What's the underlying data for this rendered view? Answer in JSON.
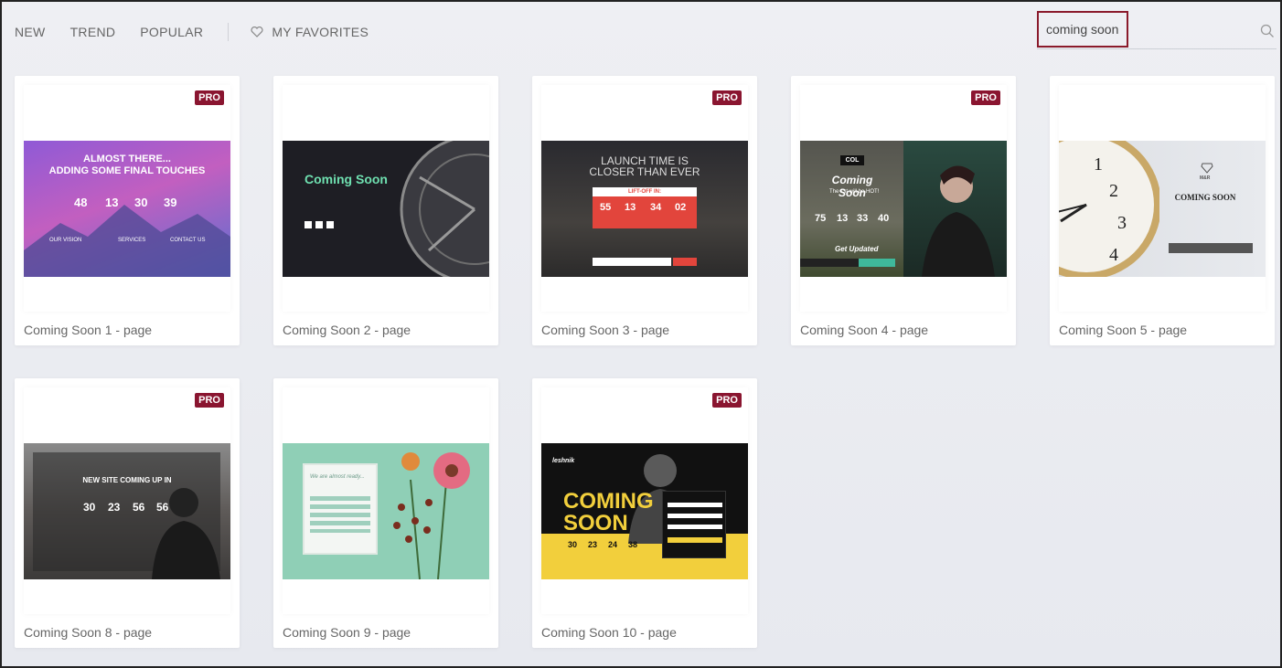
{
  "nav": {
    "tabs": [
      "NEW",
      "TREND",
      "POPULAR"
    ],
    "favorites_label": "MY FAVORITES"
  },
  "search": {
    "value": "coming soon"
  },
  "colors": {
    "pro_badge": "#8a1530",
    "search_highlight": "#8a1a2b"
  },
  "cards": [
    {
      "label": "Coming Soon 1 - page",
      "pro": true,
      "badge": "PRO",
      "thumb": {
        "headline1": "ALMOST THERE...",
        "headline2": "ADDING SOME FINAL TOUCHES",
        "nums": [
          "48",
          "13",
          "30",
          "39"
        ],
        "cols": [
          "OUR VISION",
          "SERVICES",
          "CONTACT US"
        ]
      }
    },
    {
      "label": "Coming Soon 2 - page",
      "pro": false,
      "thumb": {
        "title": "Coming Soon"
      }
    },
    {
      "label": "Coming Soon 3 - page",
      "pro": true,
      "badge": "PRO",
      "thumb": {
        "headline1": "LAUNCH TIME IS",
        "headline2": "CLOSER THAN EVER",
        "box_title": "LIFT-OFF IN:",
        "nums": [
          "55",
          "13",
          "34",
          "02"
        ]
      }
    },
    {
      "label": "Coming Soon 4 - page",
      "pro": true,
      "badge": "PRO",
      "thumb": {
        "logo": "COL",
        "title": "Coming Soon",
        "sub": "The 1st will be HOT!",
        "nums": [
          "75",
          "13",
          "33",
          "40"
        ],
        "cta": "Get Updated"
      }
    },
    {
      "label": "Coming Soon 5 - page",
      "pro": false,
      "thumb": {
        "brand": "M&R",
        "title": "COMING SOON",
        "clock": [
          "1",
          "2",
          "3",
          "4"
        ]
      }
    },
    {
      "label": "Coming Soon 8 - page",
      "pro": true,
      "badge": "PRO",
      "thumb": {
        "headline": "NEW SITE COMING UP IN",
        "nums": [
          "30",
          "23",
          "56",
          "56"
        ]
      }
    },
    {
      "label": "Coming Soon 9 - page",
      "pro": false,
      "thumb": {
        "title": "We are almost ready..."
      }
    },
    {
      "label": "Coming Soon 10 - page",
      "pro": true,
      "badge": "PRO",
      "thumb": {
        "brand": "leshnik",
        "title1": "COMING",
        "title2": "SOON",
        "nums": [
          "30",
          "23",
          "24",
          "38"
        ]
      }
    }
  ]
}
